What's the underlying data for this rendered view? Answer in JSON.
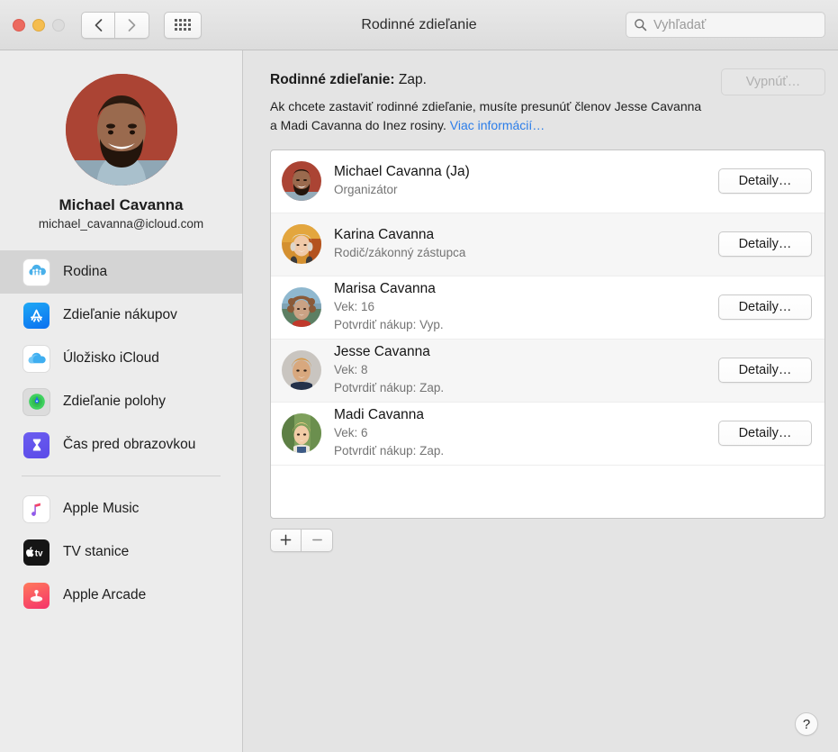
{
  "window": {
    "title": "Rodinné zdieľanie",
    "traffic": {
      "close": "close-button",
      "minimize": "minimize-button",
      "zoom": "zoom-button"
    },
    "nav": {
      "back": "‹",
      "forward": "›",
      "grid": "show-all-grid"
    },
    "search": {
      "placeholder": "Vyhľadať",
      "value": "",
      "icon": "search-icon"
    }
  },
  "sidebar": {
    "profile": {
      "name": "Michael Cavanna",
      "email": "michael_cavanna@icloud.com",
      "avatar": "avatar-michael-cavanna"
    },
    "items": [
      {
        "label": "Rodina",
        "icon": "family-icon",
        "selected": true
      },
      {
        "label": "Zdieľanie nákupov",
        "icon": "app-store-icon",
        "selected": false
      },
      {
        "label": "Úložisko iCloud",
        "icon": "icloud-icon",
        "selected": false
      },
      {
        "label": "Zdieľanie polohy",
        "icon": "find-my-icon",
        "selected": false
      },
      {
        "label": "Čas pred obrazovkou",
        "icon": "screen-time-icon",
        "selected": false
      }
    ],
    "items2": [
      {
        "label": "Apple Music",
        "icon": "apple-music-icon"
      },
      {
        "label": "TV stanice",
        "icon": "apple-tv-icon"
      },
      {
        "label": "Apple Arcade",
        "icon": "apple-arcade-icon"
      }
    ]
  },
  "main": {
    "status_label": "Rodinné zdieľanie:",
    "status_value": "Zap.",
    "description": "Ak chcete zastaviť rodinné zdieľanie, musíte presunúť členov Jesse Cavanna a Madi Cavanna do Inez rosiny.",
    "more_info_link": "Viac informácií…",
    "turn_off_button": "Vypnúť…",
    "details_button": "Detaily…",
    "add_button": "+",
    "remove_button": "—",
    "help_button": "?",
    "members": [
      {
        "name": "Michael Cavanna (Ja)",
        "line1": "Organizátor",
        "line2": "",
        "avatar": "avatar-michael"
      },
      {
        "name": "Karina Cavanna",
        "line1": "Rodič/zákonný zástupca",
        "line2": "",
        "avatar": "avatar-karina"
      },
      {
        "name": "Marisa Cavanna",
        "line1": "Vek: 16",
        "line2": "Potvrdiť nákup: Vyp.",
        "avatar": "avatar-marisa"
      },
      {
        "name": "Jesse Cavanna",
        "line1": "Vek: 8",
        "line2": "Potvrdiť nákup: Zap.",
        "avatar": "avatar-jesse"
      },
      {
        "name": "Madi Cavanna",
        "line1": "Vek: 6",
        "line2": "Potvrdiť nákup: Zap.",
        "avatar": "avatar-madi"
      }
    ]
  },
  "colors": {
    "link": "#2b7de9",
    "selected_row": "#d4d4d4",
    "sidebar_bg": "#ececec",
    "content_bg": "#e4e4e4"
  }
}
